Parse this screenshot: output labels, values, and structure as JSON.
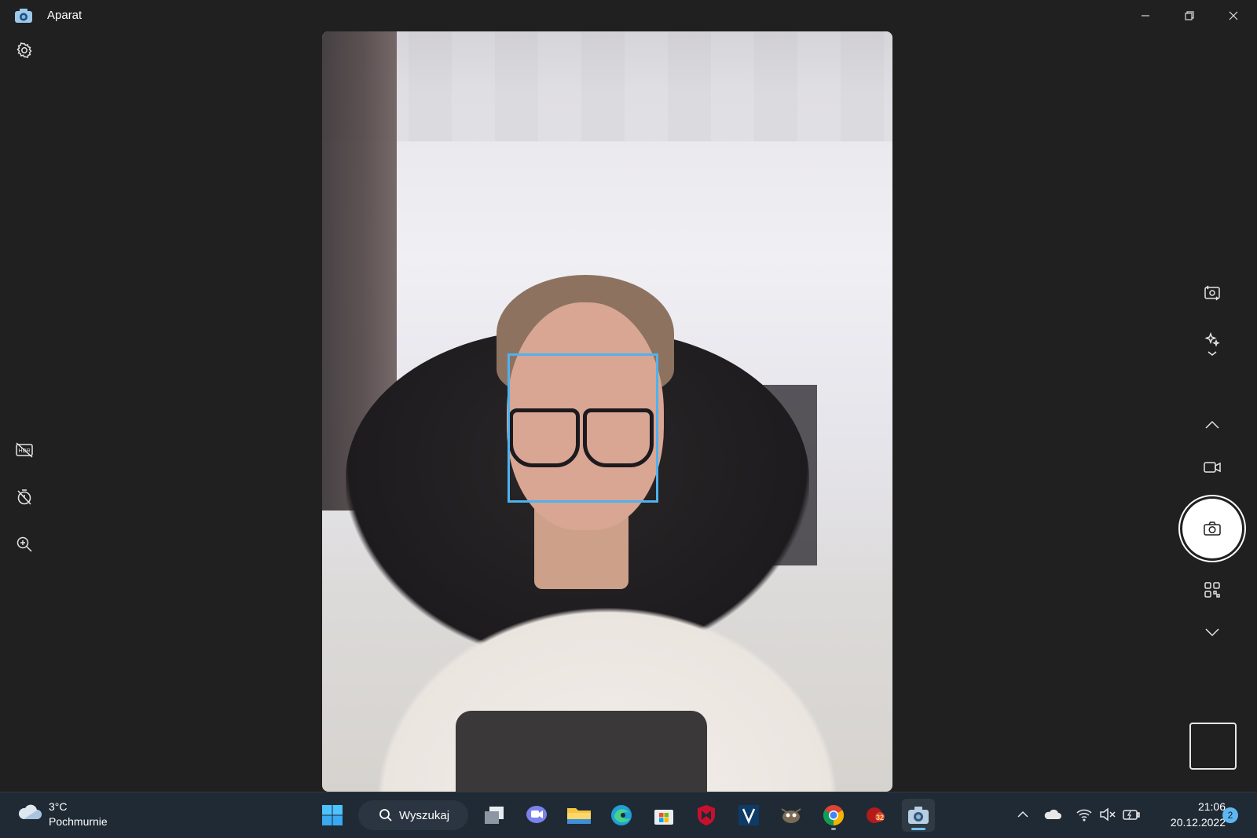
{
  "window": {
    "title": "Aparat"
  },
  "taskbar": {
    "weather": {
      "temp": "3°C",
      "desc": "Pochmurnie",
      "icon": "cloud-icon"
    },
    "search_label": "Wyszukaj",
    "clock": {
      "time": "21:06",
      "date": "20.12.2022"
    },
    "notifications": "2",
    "apps": [
      "start-icon",
      "search-icon",
      "task-view-icon",
      "chat-icon",
      "file-explorer-icon",
      "edge-icon",
      "store-icon",
      "mcafee-icon",
      "v-app-icon",
      "gimp-icon",
      "chrome-icon",
      "game-icon",
      "camera-icon"
    ]
  },
  "camera": {
    "face_detection_color": "#4fb2ef",
    "left_tools": [
      "settings-icon",
      "hdr-off-icon",
      "timer-off-icon",
      "zoom-icon"
    ],
    "right_controls": [
      "switch-camera-icon",
      "effects-icon",
      "chevron-up-icon",
      "video-mode-icon",
      "photo-shutter",
      "qr-scan-icon",
      "chevron-down-icon",
      "gallery-thumbnail"
    ]
  },
  "colors": {
    "background": "#202020",
    "taskbar": "#1f2a35",
    "accent": "#5fb6f0"
  }
}
